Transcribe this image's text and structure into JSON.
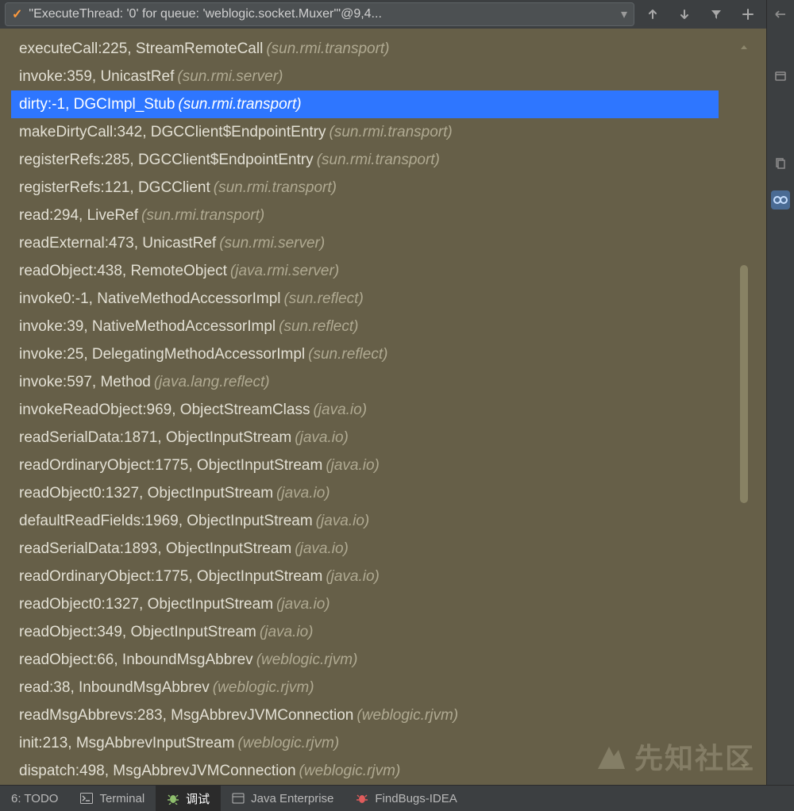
{
  "toolbar": {
    "thread_label": "\"ExecuteThread: '0' for queue: 'weblogic.socket.Muxer'\"@9,4...",
    "check_glyph": "✓",
    "chev_glyph": "▾"
  },
  "frames": [
    {
      "method": "executeCall:225, StreamRemoteCall",
      "pkg": "(sun.rmi.transport)",
      "selected": false
    },
    {
      "method": "invoke:359, UnicastRef",
      "pkg": "(sun.rmi.server)",
      "selected": false
    },
    {
      "method": "dirty:-1, DGCImpl_Stub",
      "pkg": "(sun.rmi.transport)",
      "selected": true
    },
    {
      "method": "makeDirtyCall:342, DGCClient$EndpointEntry",
      "pkg": "(sun.rmi.transport)",
      "selected": false
    },
    {
      "method": "registerRefs:285, DGCClient$EndpointEntry",
      "pkg": "(sun.rmi.transport)",
      "selected": false
    },
    {
      "method": "registerRefs:121, DGCClient",
      "pkg": "(sun.rmi.transport)",
      "selected": false
    },
    {
      "method": "read:294, LiveRef",
      "pkg": "(sun.rmi.transport)",
      "selected": false
    },
    {
      "method": "readExternal:473, UnicastRef",
      "pkg": "(sun.rmi.server)",
      "selected": false
    },
    {
      "method": "readObject:438, RemoteObject",
      "pkg": "(java.rmi.server)",
      "selected": false
    },
    {
      "method": "invoke0:-1, NativeMethodAccessorImpl",
      "pkg": "(sun.reflect)",
      "selected": false
    },
    {
      "method": "invoke:39, NativeMethodAccessorImpl",
      "pkg": "(sun.reflect)",
      "selected": false
    },
    {
      "method": "invoke:25, DelegatingMethodAccessorImpl",
      "pkg": "(sun.reflect)",
      "selected": false
    },
    {
      "method": "invoke:597, Method",
      "pkg": "(java.lang.reflect)",
      "selected": false
    },
    {
      "method": "invokeReadObject:969, ObjectStreamClass",
      "pkg": "(java.io)",
      "selected": false
    },
    {
      "method": "readSerialData:1871, ObjectInputStream",
      "pkg": "(java.io)",
      "selected": false
    },
    {
      "method": "readOrdinaryObject:1775, ObjectInputStream",
      "pkg": "(java.io)",
      "selected": false
    },
    {
      "method": "readObject0:1327, ObjectInputStream",
      "pkg": "(java.io)",
      "selected": false
    },
    {
      "method": "defaultReadFields:1969, ObjectInputStream",
      "pkg": "(java.io)",
      "selected": false
    },
    {
      "method": "readSerialData:1893, ObjectInputStream",
      "pkg": "(java.io)",
      "selected": false
    },
    {
      "method": "readOrdinaryObject:1775, ObjectInputStream",
      "pkg": "(java.io)",
      "selected": false
    },
    {
      "method": "readObject0:1327, ObjectInputStream",
      "pkg": "(java.io)",
      "selected": false
    },
    {
      "method": "readObject:349, ObjectInputStream",
      "pkg": "(java.io)",
      "selected": false
    },
    {
      "method": "readObject:66, InboundMsgAbbrev",
      "pkg": "(weblogic.rjvm)",
      "selected": false
    },
    {
      "method": "read:38, InboundMsgAbbrev",
      "pkg": "(weblogic.rjvm)",
      "selected": false
    },
    {
      "method": "readMsgAbbrevs:283, MsgAbbrevJVMConnection",
      "pkg": "(weblogic.rjvm)",
      "selected": false
    },
    {
      "method": "init:213, MsgAbbrevInputStream",
      "pkg": "(weblogic.rjvm)",
      "selected": false
    },
    {
      "method": "dispatch:498, MsgAbbrevJVMConnection",
      "pkg": "(weblogic.rjvm)",
      "selected": false
    }
  ],
  "right_rail": {
    "restore": "restore-layout-icon",
    "copy": "copy-stack-icon",
    "watch": "watch-variable-icon"
  },
  "bottom": {
    "todo": "6: TODO",
    "terminal": "Terminal",
    "debug": "调试",
    "java_ee": "Java Enterprise",
    "findbugs": "FindBugs-IDEA"
  },
  "watermark": "先知社区"
}
